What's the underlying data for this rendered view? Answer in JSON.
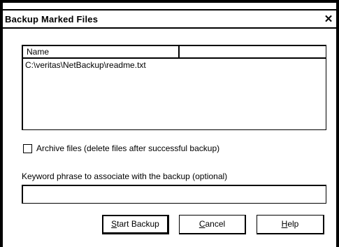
{
  "window": {
    "title": "Backup Marked Files",
    "close_glyph": "✕"
  },
  "file_list": {
    "columns": [
      "Name",
      ""
    ],
    "rows": [
      "C:\\veritas\\NetBackup\\readme.txt"
    ]
  },
  "archive_checkbox": {
    "label": "Archive files (delete files after successful backup)",
    "checked": false
  },
  "keyword": {
    "label": "Keyword phrase to associate with the backup (optional)",
    "value": ""
  },
  "buttons": {
    "start_backup": {
      "mnemonic": "S",
      "rest": "tart Backup"
    },
    "cancel": {
      "mnemonic": "C",
      "rest": "ancel"
    },
    "help": {
      "mnemonic": "H",
      "rest": "elp"
    }
  }
}
